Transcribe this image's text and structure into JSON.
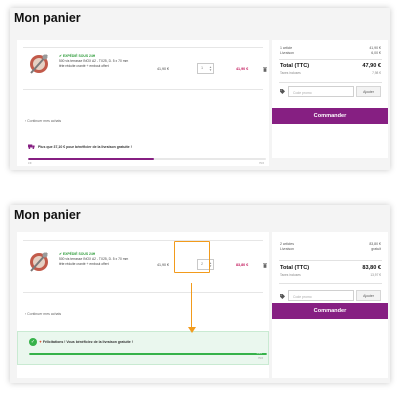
{
  "page_title": "Mon panier",
  "colors": {
    "accent": "#861f82",
    "price": "#c2185b",
    "success": "#36b24a",
    "annotation": "#f29b1c"
  },
  "cart_item": {
    "badge": "EXPÉDIÉ SOUS 24H",
    "description_line1": "500 vis terrasse INOX A2 - TX25, D. 5 x 70 mm",
    "description_line2": "tête réduite cranté + embout offert",
    "unit_price": "41,90 €"
  },
  "continue_label": "Continuer mes achats",
  "promo": {
    "placeholder": "Code promo",
    "button": "Ajouter"
  },
  "order_button": "Commander",
  "before": {
    "quantity": "1",
    "line_total": "41,90 €",
    "summary": {
      "items_label": "1 article",
      "items_value": "41,90 €",
      "shipping_label": "Livraison",
      "shipping_value": "6,00 €",
      "total_label": "Total (TTC)",
      "total_value": "47,90 €",
      "tax_label": "Taxes incluses",
      "tax_value": "7,98 €"
    },
    "shipping_message": "Plus que 37,10 € pour bénéficier de la livraison gratuite !",
    "progress": 0.53,
    "progress_min_label": "0 €",
    "progress_max_label": "79 €"
  },
  "after": {
    "quantity": "2",
    "line_total": "83,80 €",
    "summary": {
      "items_label": "2 articles",
      "items_value": "83,80 €",
      "shipping_label": "Livraison",
      "shipping_value": "gratuit",
      "total_label": "Total (TTC)",
      "total_value": "83,80 €",
      "tax_label": "Taxes incluses",
      "tax_value": "13,97 €"
    },
    "shipping_message": "Félicitations ! Vous bénéficiez de la livraison gratuite !",
    "progress": 1.0,
    "progress_end_label": "100%",
    "progress_max_label": "79 €"
  },
  "icons": {
    "product": "screw-product-icon",
    "check": "check-icon",
    "trash": "trash-icon",
    "chevron": "chevron-left-icon",
    "truck": "truck-icon",
    "tag": "tag-icon",
    "party": "party-icon",
    "check_circle": "check-circle-icon",
    "arrow": "arrow-down-icon"
  }
}
